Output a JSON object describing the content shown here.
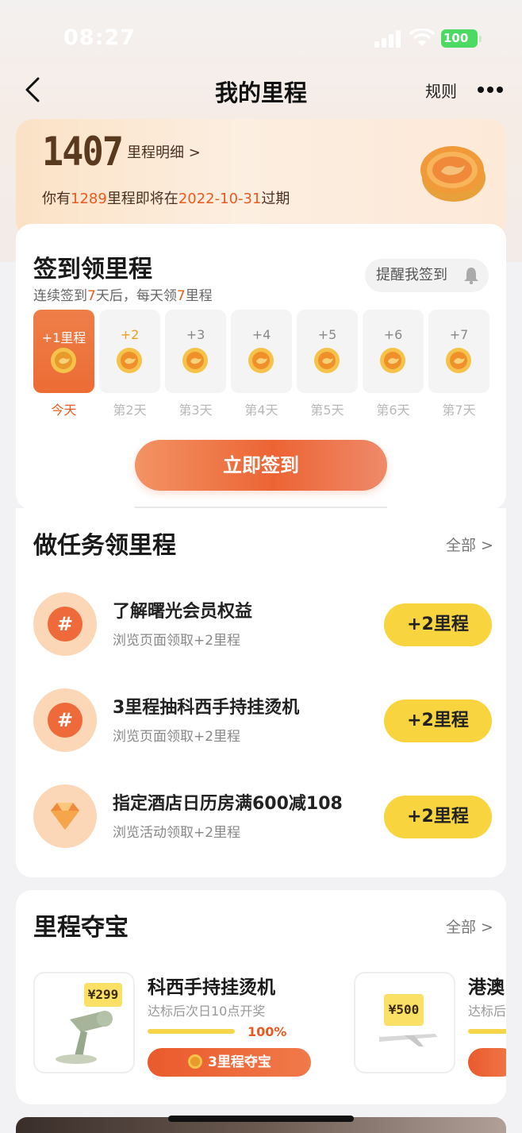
{
  "status": {
    "time": "08:27",
    "battery": "100"
  },
  "nav": {
    "title": "我的里程",
    "rules": "规则"
  },
  "header": {
    "mileage": "1407",
    "detail_link": "里程明细 >",
    "expire_prefix": "你有",
    "expire_amount": "1289",
    "expire_mid": "里程即将在",
    "expire_date": "2022-10-31",
    "expire_suffix": "过期"
  },
  "checkin": {
    "title": "签到领里程",
    "sub_prefix": "连续签到",
    "sub_days": "7",
    "sub_mid": "天后，每天领",
    "sub_amount": "7",
    "sub_suffix": "里程",
    "remind_label": "提醒我签到",
    "days": [
      {
        "amount": "+1里程",
        "label": "今天"
      },
      {
        "amount": "+2",
        "label": "第2天"
      },
      {
        "amount": "+3",
        "label": "第3天"
      },
      {
        "amount": "+4",
        "label": "第4天"
      },
      {
        "amount": "+5",
        "label": "第5天"
      },
      {
        "amount": "+6",
        "label": "第6天"
      },
      {
        "amount": "+7",
        "label": "第7天"
      }
    ],
    "button": "立即签到"
  },
  "tasks": {
    "title": "做任务领里程",
    "all_label": "全部 >",
    "items": [
      {
        "title": "了解曙光会员权益",
        "desc": "浏览页面领取+2里程",
        "button": "+2里程",
        "icon": "hashtag-icon"
      },
      {
        "title": "3里程抽科西手持挂烫机",
        "desc": "浏览页面领取+2里程",
        "button": "+2里程",
        "icon": "hashtag-icon"
      },
      {
        "title": "指定酒店日历房满600减108",
        "desc": "浏览活动领取+2里程",
        "button": "+2里程",
        "icon": "diamond-icon"
      }
    ]
  },
  "treasure": {
    "title": "里程夺宝",
    "all_label": "全部 >",
    "items": [
      {
        "name": "科西手持挂烫机",
        "open": "达标后次日10点开奖",
        "progress": "100%",
        "progress_value": 1.0,
        "button": "3里程夺宝",
        "price": "¥299"
      },
      {
        "name": "港澳",
        "open": "达标后",
        "price": "¥500"
      }
    ]
  },
  "colors": {
    "accent": "#ec6434",
    "task_button": "#f8d53e",
    "highlight": "#e85a1f"
  }
}
